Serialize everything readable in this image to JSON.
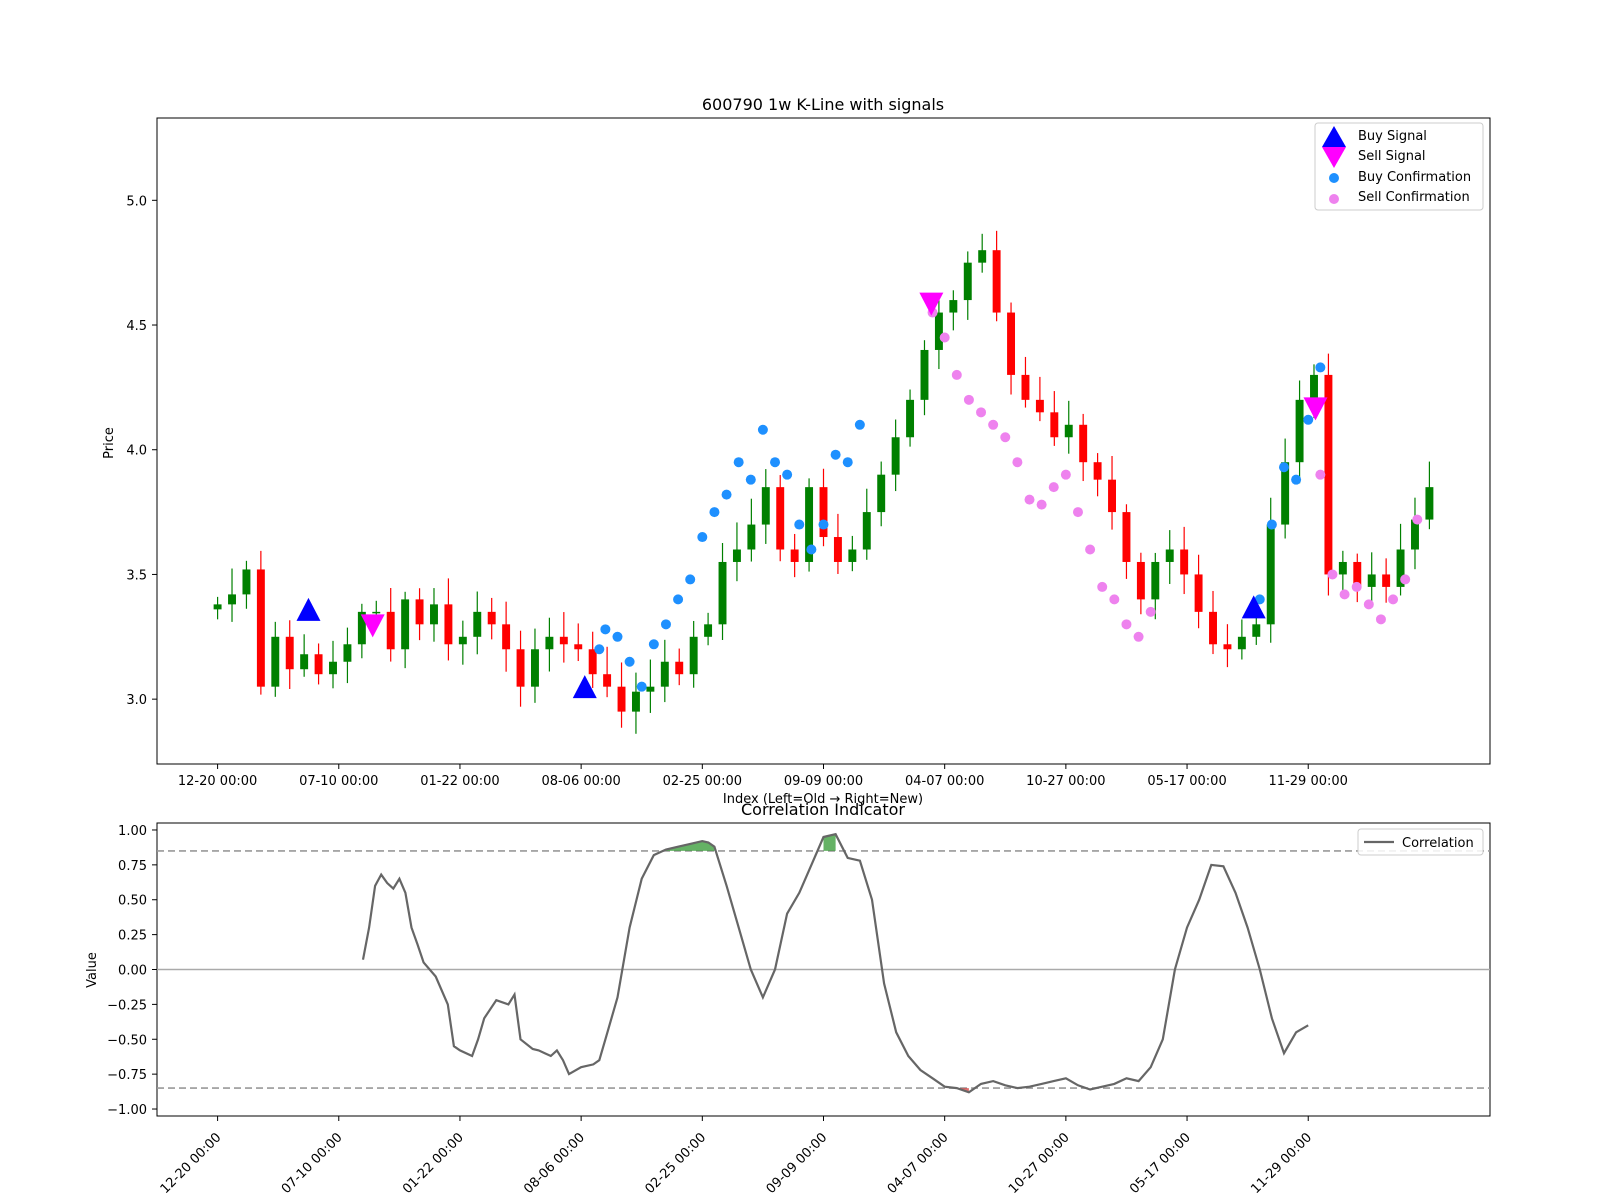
{
  "colors": {
    "up_candle": "#008000",
    "down_candle": "#ff0000",
    "buy_signal": "#0000ff",
    "sell_signal": "#ff00ff",
    "buy_confirmation": "#1e90ff",
    "sell_confirmation": "#ee82ee",
    "correlation_line": "#666666",
    "high_fill": "#3f9f3f",
    "low_fill": "#d94a4a",
    "threshold_line": "#999999"
  },
  "chart_data": [
    {
      "type": "candlestick",
      "title": "600790 1w K-Line with signals",
      "xlabel": "Index (Left=Old → Right=New)",
      "ylabel": "Price",
      "xlim": [
        -5,
        105
      ],
      "ylim": [
        2.74,
        5.33
      ],
      "ytick_labels": [
        "3.0",
        "3.5",
        "4.0",
        "4.5",
        "5.0"
      ],
      "xticks": [
        {
          "index": 0,
          "label": "12-20 00:00"
        },
        {
          "index": 10,
          "label": "07-10 00:00"
        },
        {
          "index": 20,
          "label": "01-22 00:00"
        },
        {
          "index": 30,
          "label": "08-06 00:00"
        },
        {
          "index": 40,
          "label": "02-25 00:00"
        },
        {
          "index": 50,
          "label": "09-09 00:00"
        },
        {
          "index": 60,
          "label": "04-07 00:00"
        },
        {
          "index": 70,
          "label": "10-27 00:00"
        },
        {
          "index": 80,
          "label": "05-17 00:00"
        },
        {
          "index": 90,
          "label": "11-29 00:00"
        }
      ],
      "close": [
        3.38,
        3.42,
        3.52,
        3.05,
        3.25,
        3.12,
        3.18,
        3.1,
        3.15,
        3.22,
        3.35,
        3.35,
        3.2,
        3.4,
        3.3,
        3.38,
        3.22,
        3.25,
        3.35,
        3.3,
        3.2,
        3.05,
        3.2,
        3.25,
        3.22,
        3.2,
        3.1,
        3.05,
        2.95,
        3.03,
        3.05,
        3.15,
        3.1,
        3.25,
        3.3,
        3.55,
        3.6,
        3.7,
        3.85,
        3.6,
        3.55,
        3.85,
        3.65,
        3.55,
        3.6,
        3.75,
        3.9,
        4.05,
        4.2,
        4.4,
        4.55,
        4.6,
        4.75,
        4.8,
        4.55,
        4.3,
        4.2,
        4.15,
        4.05,
        4.1,
        3.95,
        3.88,
        3.75,
        3.55,
        3.4,
        3.55,
        3.6,
        3.5,
        3.35,
        3.22,
        3.2,
        3.25,
        3.3,
        3.7,
        3.95,
        4.2,
        4.3,
        3.5,
        3.55,
        3.45,
        3.5,
        3.45,
        3.6,
        3.72,
        3.85
      ],
      "signals": {
        "buy": [
          {
            "index": 7.5,
            "price": 3.35
          },
          {
            "index": 30.3,
            "price": 3.04
          },
          {
            "index": 85.5,
            "price": 3.36
          }
        ],
        "sell": [
          {
            "index": 12.8,
            "price": 3.3
          },
          {
            "index": 58.9,
            "price": 4.59
          },
          {
            "index": 90.6,
            "price": 4.17
          }
        ]
      },
      "confirmations": {
        "buy": [
          [
            31.5,
            3.2
          ],
          [
            32,
            3.28
          ],
          [
            33,
            3.25
          ],
          [
            34,
            3.15
          ],
          [
            35,
            3.05
          ],
          [
            36,
            3.22
          ],
          [
            37,
            3.3
          ],
          [
            38,
            3.4
          ],
          [
            39,
            3.48
          ],
          [
            40,
            3.65
          ],
          [
            41,
            3.75
          ],
          [
            42,
            3.82
          ],
          [
            43,
            3.95
          ],
          [
            44,
            3.88
          ],
          [
            45,
            4.08
          ],
          [
            46,
            3.95
          ],
          [
            47,
            3.9
          ],
          [
            48,
            3.7
          ],
          [
            49,
            3.6
          ],
          [
            50,
            3.7
          ],
          [
            51,
            3.98
          ],
          [
            52,
            3.95
          ],
          [
            53,
            4.1
          ],
          [
            86,
            3.4
          ],
          [
            87,
            3.7
          ],
          [
            88,
            3.93
          ],
          [
            89,
            3.88
          ],
          [
            90,
            4.12
          ],
          [
            91,
            4.33
          ]
        ],
        "sell": [
          [
            59,
            4.55
          ],
          [
            60,
            4.45
          ],
          [
            61,
            4.3
          ],
          [
            62,
            4.2
          ],
          [
            63,
            4.15
          ],
          [
            64,
            4.1
          ],
          [
            65,
            4.05
          ],
          [
            66,
            3.95
          ],
          [
            67,
            3.8
          ],
          [
            68,
            3.78
          ],
          [
            69,
            3.85
          ],
          [
            70,
            3.9
          ],
          [
            71,
            3.75
          ],
          [
            72,
            3.6
          ],
          [
            73,
            3.45
          ],
          [
            74,
            3.4
          ],
          [
            75,
            3.3
          ],
          [
            76,
            3.25
          ],
          [
            77,
            3.35
          ],
          [
            91,
            3.9
          ],
          [
            92,
            3.5
          ],
          [
            93,
            3.42
          ],
          [
            94,
            3.45
          ],
          [
            95,
            3.38
          ],
          [
            96,
            3.32
          ],
          [
            97,
            3.4
          ],
          [
            98,
            3.48
          ],
          [
            99,
            3.72
          ]
        ]
      },
      "legend": {
        "position": "top-right",
        "entries": [
          "Buy Signal",
          "Sell Signal",
          "Buy Confirmation",
          "Sell Confirmation"
        ]
      }
    },
    {
      "type": "line",
      "title": "Correlation Indicator",
      "xlabel": "",
      "ylabel": "Value",
      "xlim": [
        -5,
        105
      ],
      "ylim": [
        -1.05,
        1.05
      ],
      "ytick_labels": [
        "1.00",
        "0.75",
        "0.50",
        "0.25",
        "0.00",
        "−0.25",
        "−0.50",
        "−0.75",
        "−1.00"
      ],
      "xtick_labels": [
        "12-20 00:00",
        "07-10 00:00",
        "01-22 00:00",
        "08-06 00:00",
        "02-25 00:00",
        "09-09 00:00",
        "04-07 00:00",
        "10-27 00:00",
        "05-17 00:00",
        "11-29 00:00"
      ],
      "thresholds": [
        0.85,
        -0.85
      ],
      "zero_line": true,
      "x": [
        12,
        12.5,
        13,
        13.5,
        14,
        14.5,
        15,
        15.5,
        16,
        16.5,
        17,
        18,
        19,
        19.5,
        20,
        21,
        21.5,
        22,
        23,
        24,
        24.5,
        25,
        26,
        26.5,
        27,
        27.5,
        28,
        28.5,
        29,
        30,
        31,
        31.5,
        32,
        33,
        34,
        35,
        36,
        37,
        38,
        39,
        40,
        40.5,
        41,
        42,
        43,
        44,
        45,
        46,
        47,
        48,
        49,
        50,
        51,
        52,
        53,
        54,
        55,
        56,
        57,
        58,
        59,
        60,
        61,
        62,
        63,
        64,
        65,
        66,
        67,
        68,
        69,
        70,
        71,
        72,
        73,
        74,
        75,
        76,
        77,
        78,
        79,
        80,
        81,
        82,
        83,
        84,
        85,
        86,
        87,
        88,
        89,
        90,
        91,
        92,
        93,
        94,
        95,
        96,
        97,
        98,
        99,
        99.5,
        100
      ],
      "values": [
        0.07,
        0.3,
        0.6,
        0.68,
        0.62,
        0.58,
        0.65,
        0.55,
        0.3,
        0.18,
        0.05,
        -0.05,
        -0.25,
        -0.55,
        -0.58,
        -0.62,
        -0.5,
        -0.35,
        -0.22,
        -0.25,
        -0.18,
        -0.5,
        -0.57,
        -0.58,
        -0.6,
        -0.62,
        -0.58,
        -0.65,
        -0.75,
        -0.7,
        -0.68,
        -0.65,
        -0.5,
        -0.2,
        0.3,
        0.65,
        0.82,
        0.86,
        0.88,
        0.9,
        0.92,
        0.91,
        0.88,
        0.6,
        0.3,
        0.0,
        -0.2,
        0.0,
        0.4,
        0.55,
        0.75,
        0.95,
        0.97,
        0.8,
        0.78,
        0.5,
        -0.1,
        -0.45,
        -0.62,
        -0.72,
        -0.78,
        -0.84,
        -0.85,
        -0.88,
        -0.82,
        -0.8,
        -0.83,
        -0.85,
        -0.84,
        -0.82,
        -0.8,
        -0.78,
        -0.83,
        -0.86,
        -0.84,
        -0.82,
        -0.78,
        -0.8,
        -0.7,
        -0.5,
        0.0,
        0.3,
        0.5,
        0.75,
        0.74,
        0.55,
        0.3,
        0.0,
        -0.35,
        -0.6,
        -0.45,
        -0.4
      ],
      "legend": {
        "position": "top-right",
        "entries": [
          "Correlation"
        ]
      }
    }
  ]
}
